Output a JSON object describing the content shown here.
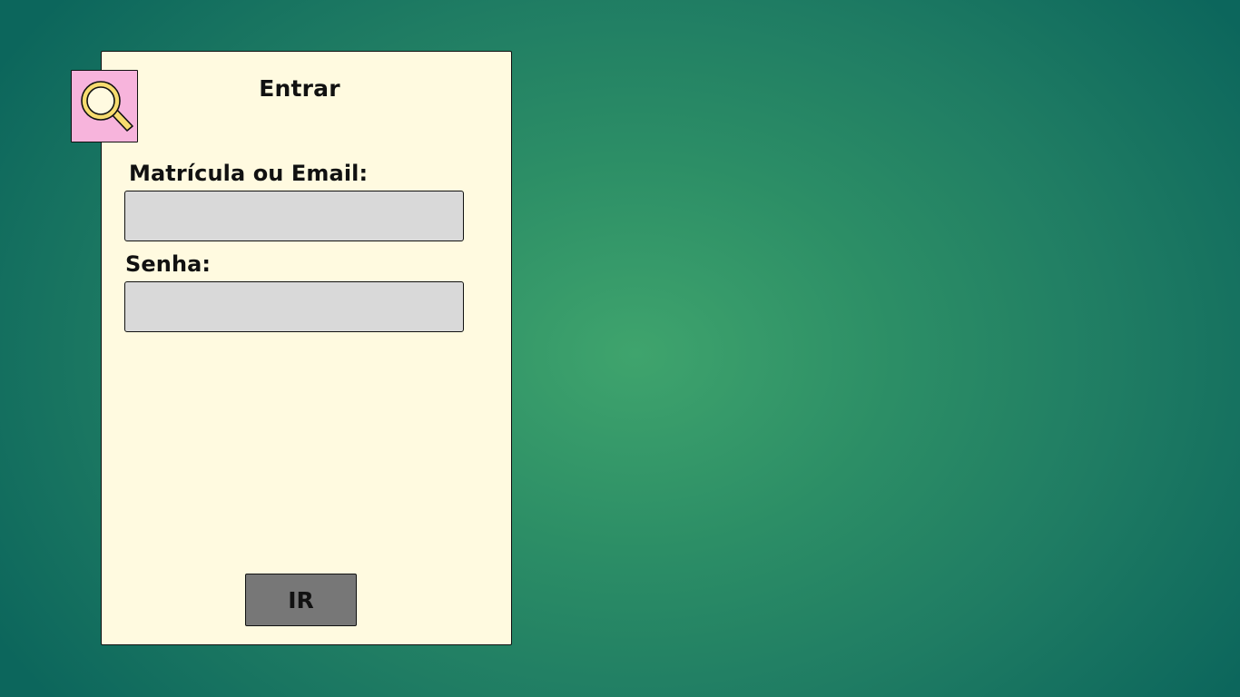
{
  "login_card": {
    "title": "Entrar",
    "login_label": "Matrícula ou Email:",
    "login_value": "",
    "password_label": "Senha:",
    "password_value": "",
    "submit_label": "IR",
    "logo_icon": "magnifier-icon"
  },
  "colors": {
    "card_background": "#fffae0",
    "logo_background": "#f7b4dc",
    "field_background": "#d9d9d9",
    "button_background": "#777777",
    "magnifier_yellow": "#f7dc6f"
  }
}
